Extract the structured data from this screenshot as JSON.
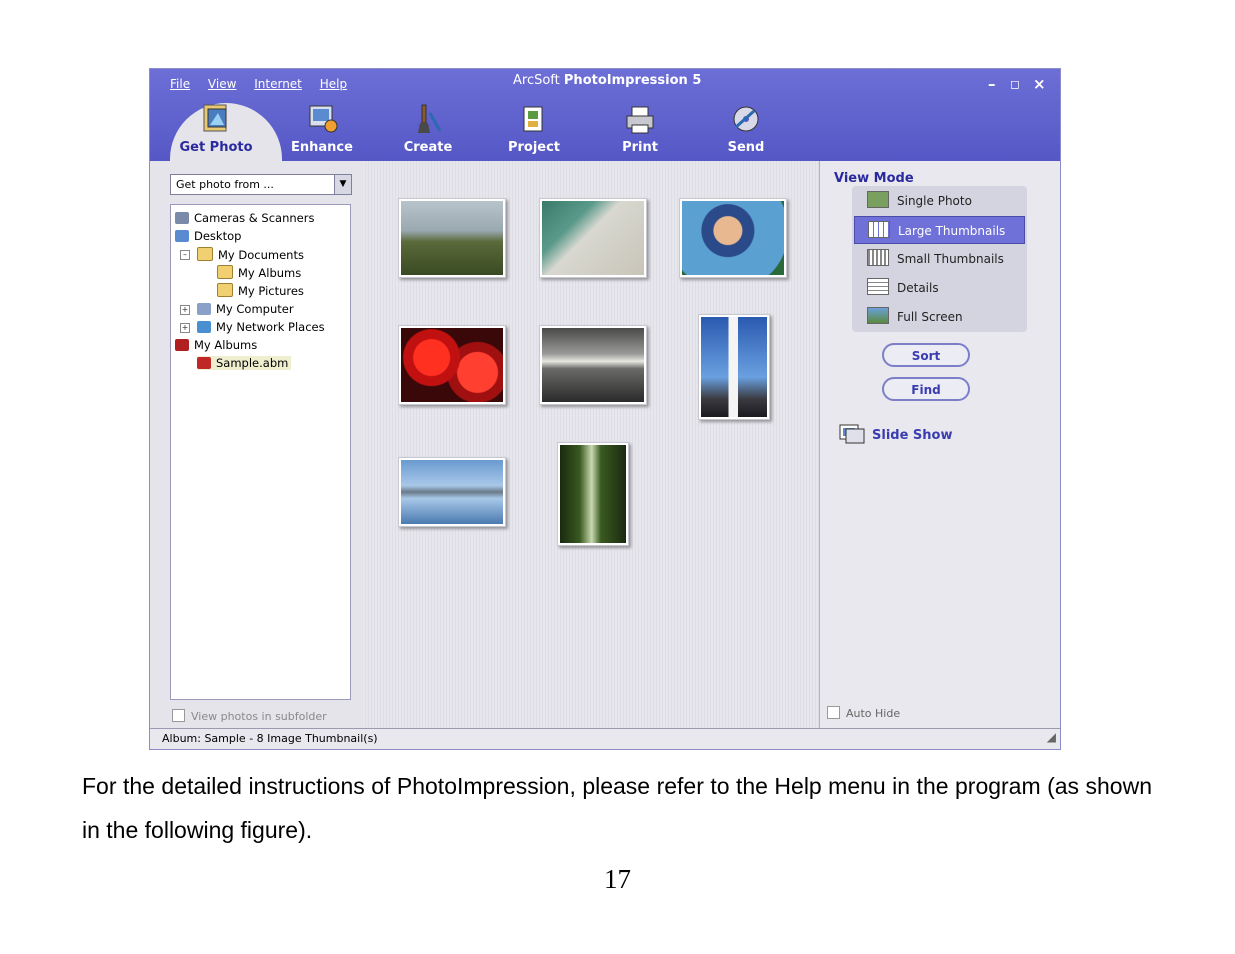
{
  "window": {
    "title_prefix": "ArcSoft",
    "title_bold": "PhotoImpression 5",
    "menu": [
      "File",
      "View",
      "Internet",
      "Help"
    ],
    "controls": {
      "minimize": "–",
      "maximize": "◻",
      "close": "×"
    }
  },
  "toolbar": {
    "tabs": [
      {
        "label": "Get Photo",
        "icon": "camera-photo-icon",
        "active": true
      },
      {
        "label": "Enhance",
        "icon": "enhance-icon"
      },
      {
        "label": "Create",
        "icon": "create-brush-icon"
      },
      {
        "label": "Project",
        "icon": "project-icon"
      },
      {
        "label": "Print",
        "icon": "printer-icon"
      },
      {
        "label": "Send",
        "icon": "send-cd-icon"
      }
    ]
  },
  "source": {
    "combo_value": "Get photo from ...",
    "tree": [
      {
        "label": "Cameras & Scanners",
        "icon": "camera-icon",
        "level": 0
      },
      {
        "label": "Desktop",
        "icon": "desktop-icon",
        "level": 0
      },
      {
        "label": "My Documents",
        "icon": "folder-icon",
        "level": 1,
        "expander": "–"
      },
      {
        "label": "My Albums",
        "icon": "folder-icon",
        "level": 2
      },
      {
        "label": "My Pictures",
        "icon": "folder-icon",
        "level": 2
      },
      {
        "label": "My Computer",
        "icon": "computer-icon",
        "level": 1,
        "expander": "+"
      },
      {
        "label": "My Network Places",
        "icon": "network-icon",
        "level": 1,
        "expander": "+"
      },
      {
        "label": "My Albums",
        "icon": "album-book-icon",
        "level": 0
      },
      {
        "label": "Sample.abm",
        "icon": "album-file-icon",
        "level": 1,
        "selected": true
      }
    ],
    "subfolder_label": "View photos in subfolder"
  },
  "view_mode": {
    "title": "View Mode",
    "options": [
      {
        "label": "Single Photo",
        "selected": false
      },
      {
        "label": "Large Thumbnails",
        "selected": true
      },
      {
        "label": "Small Thumbnails",
        "selected": false
      },
      {
        "label": "Details",
        "selected": false
      },
      {
        "label": "Full Screen",
        "selected": false
      }
    ],
    "sort_label": "Sort",
    "find_label": "Find",
    "slideshow_label": "Slide Show",
    "autohide_label": "Auto Hide"
  },
  "thumbnails": [
    {
      "subject": "grassland"
    },
    {
      "subject": "beach"
    },
    {
      "subject": "child"
    },
    {
      "subject": "red-flowers"
    },
    {
      "subject": "sunset-sea"
    },
    {
      "subject": "lighthouse"
    },
    {
      "subject": "lake"
    },
    {
      "subject": "forest"
    }
  ],
  "status": {
    "text": "Album: Sample - 8 Image Thumbnail(s)"
  },
  "document": {
    "paragraph": "For the detailed instructions of PhotoImpression, please refer to the Help menu in the program (as shown in the following figure).",
    "page_number": "17"
  }
}
